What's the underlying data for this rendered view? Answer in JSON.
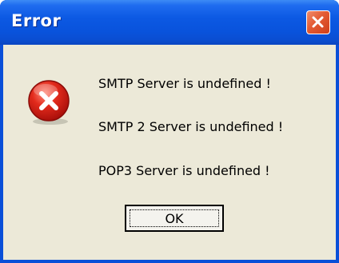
{
  "window": {
    "title": "Error"
  },
  "icons": {
    "error": "error-icon",
    "close": "close-icon"
  },
  "messages": [
    "SMTP Server is undefined !",
    "SMTP 2 Server is undefined !",
    "POP3 Server is undefined !"
  ],
  "buttons": {
    "ok_label": "OK"
  },
  "colors": {
    "titlebar": "#0953dc",
    "dialog_background": "#ece9d8",
    "close_button": "#e35a32",
    "error_icon": "#d8221a"
  }
}
